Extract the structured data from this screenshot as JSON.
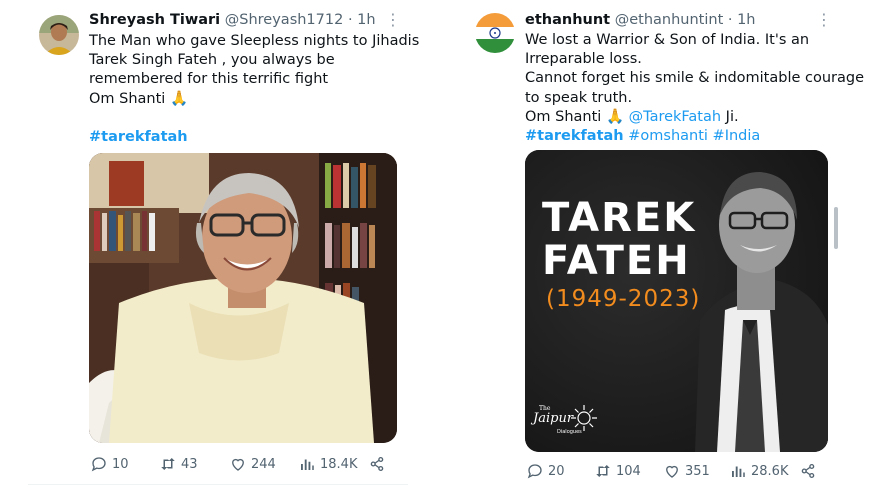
{
  "left_tweet": {
    "display_name": "Shreyash Tiwari",
    "handle": "@Shreyash1712",
    "separator": "·",
    "time": "1h",
    "lines": [
      "The Man who  gave Sleepless nights to Jihadis",
      "Tarek Singh Fateh , you always be",
      "remembered for this terrific fight",
      "Om Shanti 🙏"
    ],
    "hashtag": "#tarekfatah",
    "stats": {
      "replies": "10",
      "retweets": "43",
      "likes": "244",
      "views": "18.4K"
    }
  },
  "right_tweet": {
    "display_name": "ethanhunt",
    "handle": "@ethanhuntint",
    "separator": "·",
    "time": "1h",
    "lines": [
      "We lost a Warrior & Son of India. It's an",
      "Irreparable loss.",
      "Cannot forget his smile & indomitable courage",
      "to speak truth."
    ],
    "line5_prefix": "Om Shanti 🙏 ",
    "mention": "@TarekFatah",
    "line5_suffix": " Ji.",
    "hashtags": [
      "#tarekfatah",
      "#omshanti",
      "#India"
    ],
    "poster": {
      "title_line1": "TAREK",
      "title_line2": "FATEH",
      "years": "(1949-2023)",
      "brand_small": "The",
      "brand": "Jaipur",
      "brand_sub": "Dialogues"
    },
    "stats": {
      "replies": "20",
      "retweets": "104",
      "likes": "351",
      "views": "28.6K"
    }
  },
  "colors": {
    "link": "#1d9bf0",
    "muted": "#536471",
    "poster_bg": "#1b1b1b",
    "poster_years": "#f28c1e"
  }
}
